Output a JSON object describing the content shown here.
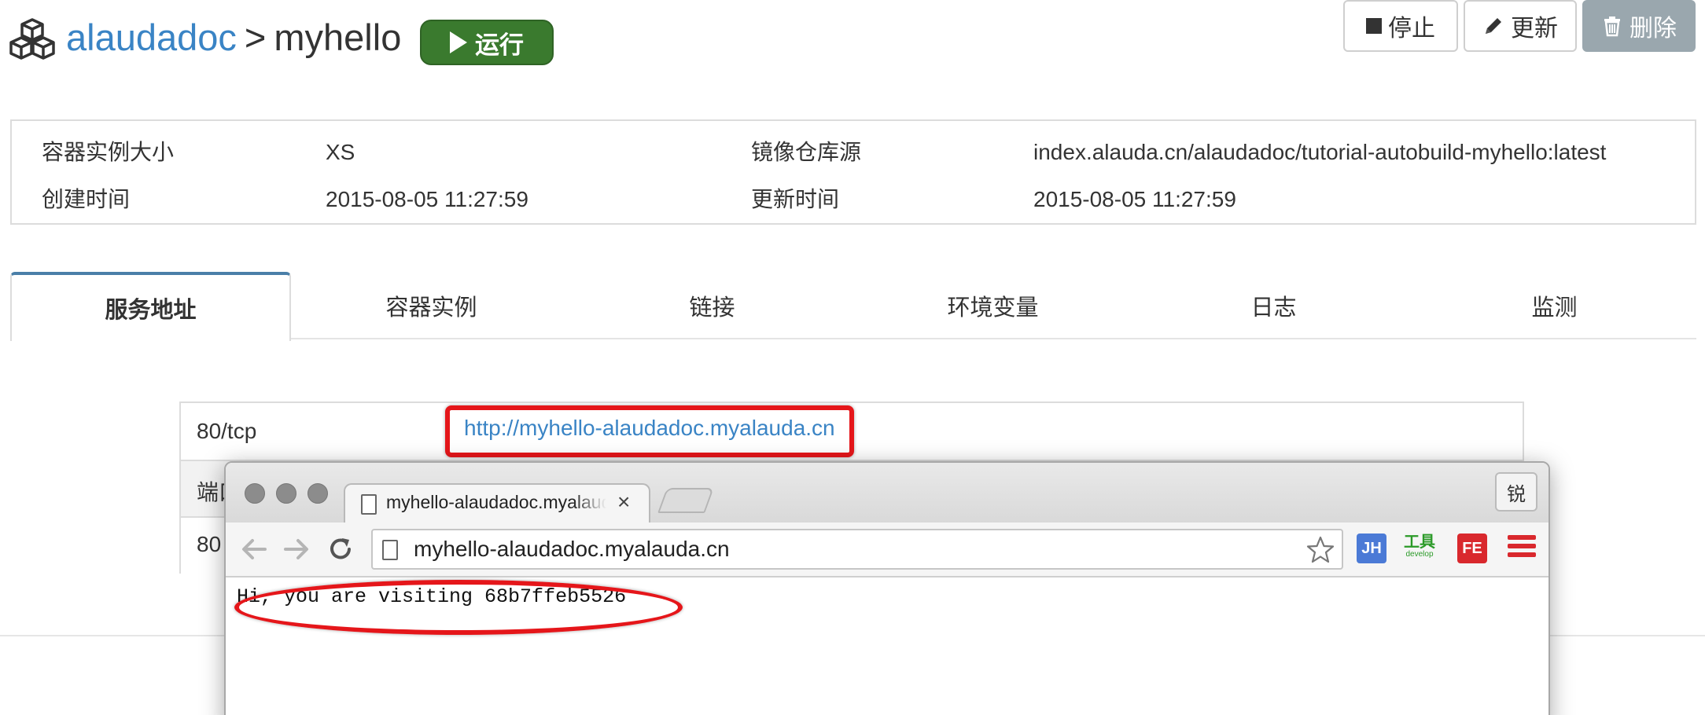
{
  "header": {
    "crumb_parent": "alaudadoc",
    "crumb_separator": ">",
    "crumb_current": "myhello",
    "run_label": "运行",
    "stop_label": "停止",
    "update_label": "更新",
    "delete_label": "删除"
  },
  "info": {
    "size_label": "容器实例大小",
    "size_value": "XS",
    "image_label": "镜像仓库源",
    "image_value": "index.alauda.cn/alaudadoc/tutorial-autobuild-myhello:latest",
    "created_label": "创建时间",
    "created_value": "2015-08-05 11:27:59",
    "updated_label": "更新时间",
    "updated_value": "2015-08-05 11:27:59"
  },
  "tabs": [
    "服务地址",
    "容器实例",
    "链接",
    "环境变量",
    "日志",
    "监测"
  ],
  "ports": {
    "row1_port": "80/tcp",
    "row1_url": "http://myhello-alaudadoc.myalauda.cn",
    "row2_label": "端口",
    "row3_port": "80"
  },
  "browser": {
    "tab_title": "myhello-alaudadoc.myalauda.cn",
    "tab_close": "×",
    "profile_label": "锐",
    "address": "myhello-alaudadoc.myalauda.cn",
    "ext_jh": "JH",
    "ext_tools": "工具",
    "ext_tools_sub": "develop",
    "ext_fe": "FE",
    "page_text": "Hi, you are visiting 68b7ffeb5526"
  },
  "colors": {
    "link": "#3a84c5",
    "run_green": "#3a7a2e",
    "delete_gray": "#9aa7ae",
    "annotation_red": "#e5161a",
    "tab_active_top": "#4a7fa8"
  }
}
